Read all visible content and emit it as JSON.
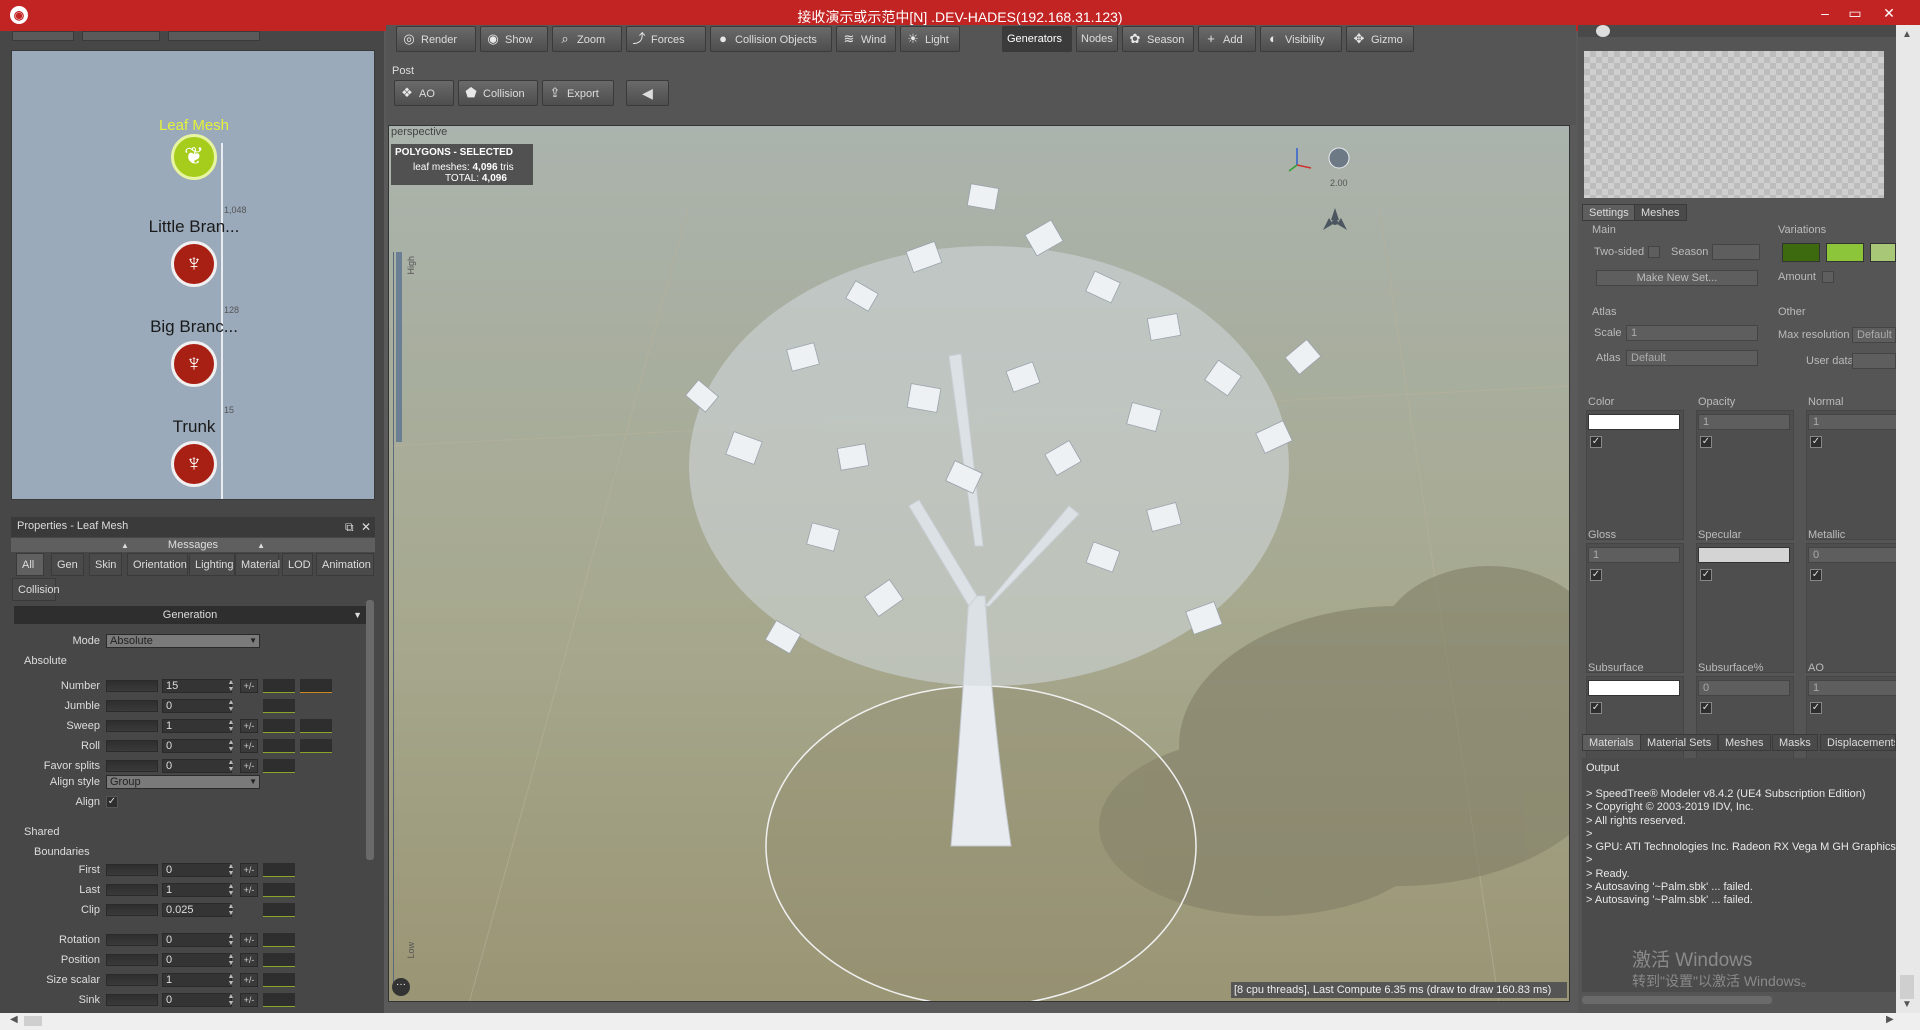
{
  "window": {
    "title": "接收演示或示范中[N] .DEV-HADES(192.168.31.123)",
    "min": "–",
    "max": "▭",
    "close": "✕"
  },
  "toolbar": {
    "row1": [
      {
        "label": "Render",
        "icon": "render-icon",
        "glyph": "◎"
      },
      {
        "label": "Show",
        "icon": "eye-icon",
        "glyph": "◉"
      },
      {
        "label": "Zoom",
        "icon": "zoom-icon",
        "glyph": "⌕"
      },
      {
        "label": "Forces",
        "icon": "forces-icon",
        "glyph": "⤴"
      },
      {
        "label": "Collision Objects",
        "icon": "collision-objects-icon",
        "glyph": "●"
      },
      {
        "label": "Wind",
        "icon": "wind-icon",
        "glyph": "≋"
      },
      {
        "label": "Light",
        "icon": "light-icon",
        "glyph": "☀"
      }
    ],
    "row1b": [
      {
        "label": "Generators",
        "icon": "",
        "glyph": ""
      },
      {
        "label": "Nodes",
        "icon": "",
        "glyph": ""
      },
      {
        "label": "Season",
        "icon": "season-icon",
        "glyph": "✿"
      },
      {
        "label": "Add",
        "icon": "add-icon",
        "glyph": "+"
      },
      {
        "label": "Visibility",
        "icon": "visibility-icon",
        "glyph": "◐"
      },
      {
        "label": "Gizmo",
        "icon": "gizmo-icon",
        "glyph": "✥"
      }
    ],
    "post_label": "Post",
    "row2": [
      {
        "label": "AO",
        "icon": "ao-icon",
        "glyph": "❖"
      },
      {
        "label": "Collision",
        "icon": "collision-icon",
        "glyph": "⬟"
      },
      {
        "label": "Export",
        "icon": "export-icon",
        "glyph": "⇪"
      }
    ]
  },
  "graph": {
    "nodes": [
      {
        "name": "Leaf Mesh",
        "count": "",
        "type": "leaf"
      },
      {
        "name": "Little Bran...",
        "count": "1,048",
        "type": "branch"
      },
      {
        "name": "Big Branc...",
        "count": "128",
        "type": "branch"
      },
      {
        "name": "Trunk",
        "count": "15",
        "type": "branch"
      }
    ]
  },
  "properties": {
    "title": "Properties - Leaf Mesh",
    "messages": "Messages",
    "tabs": [
      "All",
      "Gen",
      "Skin",
      "Orientation",
      "Lighting",
      "Material",
      "LOD",
      "Animation"
    ],
    "tab_row2": "Collision",
    "section": "Generation",
    "mode_label": "Mode",
    "mode_value": "Absolute",
    "absolute_label": "Absolute",
    "rows": [
      {
        "label": "Number",
        "value": "15"
      },
      {
        "label": "Jumble",
        "value": "0"
      },
      {
        "label": "Sweep",
        "value": "1"
      },
      {
        "label": "Roll",
        "value": "0"
      },
      {
        "label": "Favor splits",
        "value": "0"
      }
    ],
    "align_style_label": "Align style",
    "align_style_value": "Group",
    "align_label": "Align",
    "align_checked": "✓",
    "shared_label": "Shared",
    "boundaries_label": "Boundaries",
    "boundary_rows": [
      {
        "label": "First",
        "value": "0"
      },
      {
        "label": "Last",
        "value": "1"
      },
      {
        "label": "Clip",
        "value": "0.025"
      }
    ],
    "shared_rows": [
      {
        "label": "Rotation",
        "value": "0"
      },
      {
        "label": "Position",
        "value": "0"
      },
      {
        "label": "Size scalar",
        "value": "1"
      },
      {
        "label": "Sink",
        "value": "0"
      }
    ],
    "pm": "+/-",
    "side_high": "High",
    "side_low": "Low"
  },
  "viewport": {
    "label": "perspective",
    "overlay_title": "POLYGONS - SELECTED",
    "overlay_line1_label": "leaf meshes:",
    "overlay_line1_value": "4,096",
    "overlay_line1_unit": "tris",
    "overlay_line2_label": "TOTAL:",
    "overlay_line2_value": "4,096",
    "zoom": "2.00",
    "status": "[8 cpu threads], Last Compute 6.35 ms (draw to draw 160.83 ms)",
    "more": "···"
  },
  "right": {
    "tabs": [
      "Settings",
      "Meshes"
    ],
    "main_label": "Main",
    "two_sided": "Two-sided",
    "season": "Season",
    "make_new_set": "Make New Set...",
    "variations_label": "Variations",
    "amount_label": "Amount",
    "atlas_label": "Atlas",
    "scale_label": "Scale",
    "scale_value": "1",
    "atlas_field_label": "Atlas",
    "atlas_value": "Default",
    "other_label": "Other",
    "max_res_label": "Max resolution",
    "max_res_value": "Default",
    "user_data_label": "User data",
    "variation_colors": [
      "#3d6a0e",
      "#8cc43a",
      "#a8c878"
    ],
    "boxes": [
      {
        "label": "Color",
        "value": "",
        "swatch": "#ffffff"
      },
      {
        "label": "Opacity",
        "value": "1",
        "swatch": ""
      },
      {
        "label": "Normal",
        "value": "1",
        "swatch": ""
      },
      {
        "label": "Gloss",
        "value": "1",
        "swatch": ""
      },
      {
        "label": "Specular",
        "value": "",
        "swatch": "#d4d4d4"
      },
      {
        "label": "Metallic",
        "value": "0",
        "swatch": ""
      },
      {
        "label": "Subsurface",
        "value": "",
        "swatch": "#ffffff"
      },
      {
        "label": "Subsurface%",
        "value": "0",
        "swatch": ""
      },
      {
        "label": "AO",
        "value": "1",
        "swatch": ""
      }
    ],
    "check": "✓",
    "bottom_tabs": [
      "Materials",
      "Material Sets",
      "Meshes",
      "Masks",
      "Displacements"
    ],
    "output_label": "Output",
    "output_lines": [
      "> SpeedTree® Modeler v8.4.2 (UE4 Subscription Edition)",
      "> Copyright © 2003-2019 IDV, Inc.",
      "> All rights reserved.",
      ">",
      "> GPU: ATI Technologies Inc. Radeon RX Vega M GH Graphics, Op",
      ">",
      "> Ready.",
      "> Autosaving '~Palm.sbk' ... failed.",
      "> Autosaving '~Palm.sbk' ... failed."
    ],
    "watermark1": "激活 Windows",
    "watermark2": "转到\"设置\"以激活 Windows。"
  }
}
